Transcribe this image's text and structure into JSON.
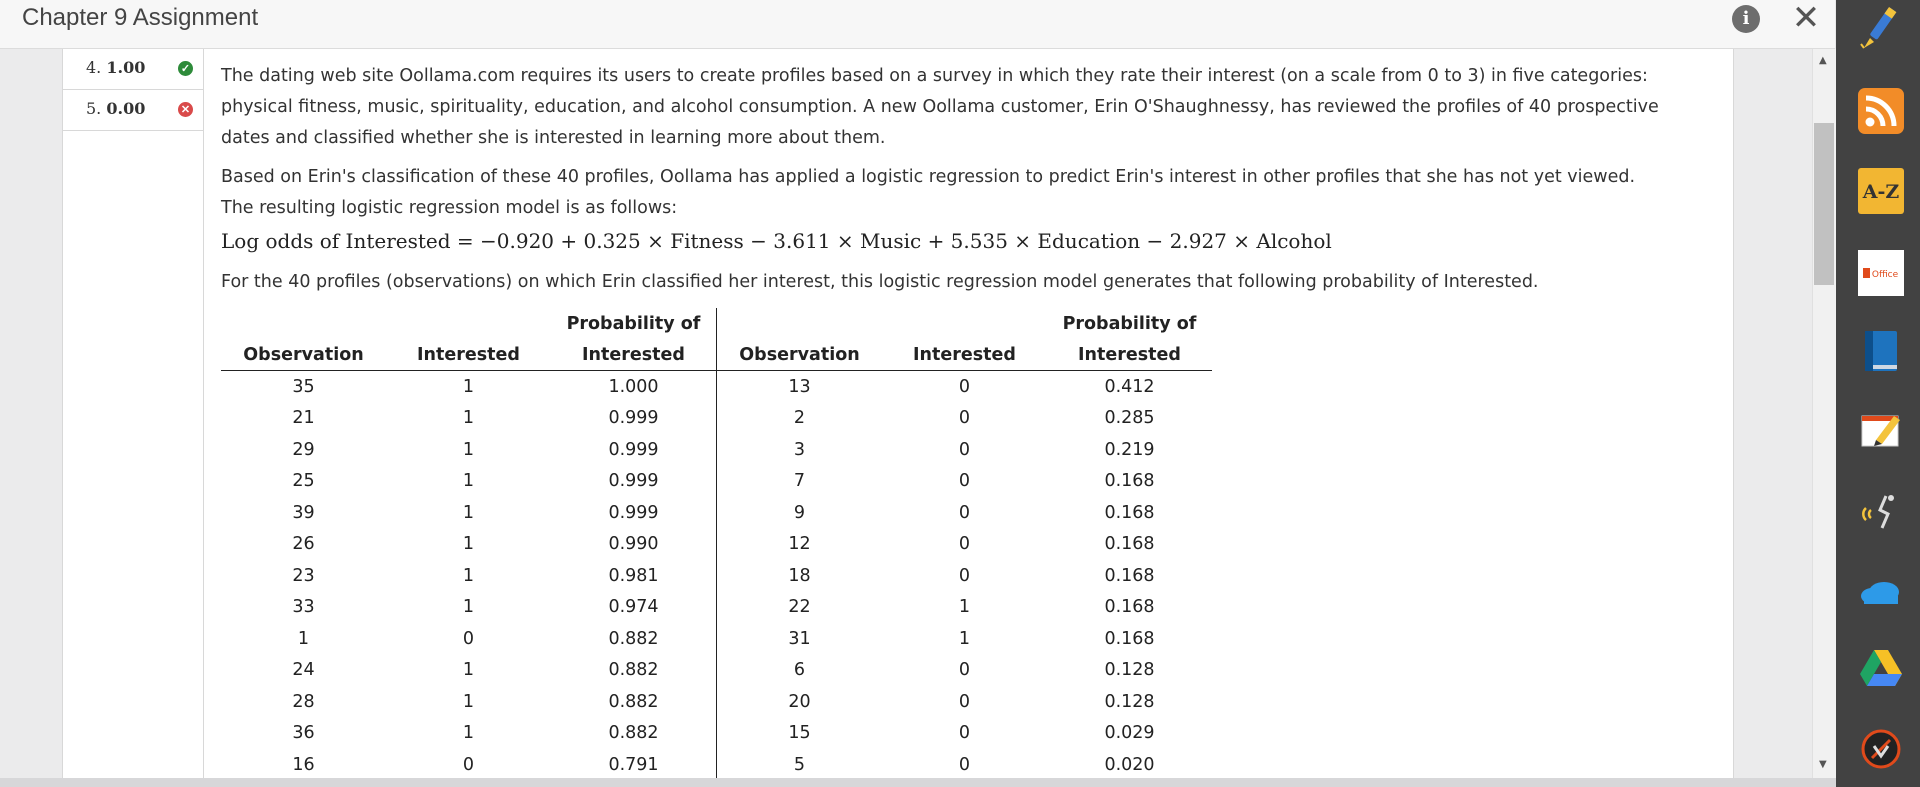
{
  "window": {
    "title": "Chapter 9 Assignment",
    "info_glyph": "i",
    "close_glyph": "✕"
  },
  "question_nav": [
    {
      "number": "4.",
      "score": "1.00",
      "status": "correct",
      "status_glyph": "✓"
    },
    {
      "number": "5.",
      "score": "0.00",
      "status": "incorrect",
      "status_glyph": "✕"
    }
  ],
  "question": {
    "p1_line1": "The dating web site Oollama.com requires its users to create profiles based on a survey in which they rate their interest (on a scale from 0 to 3) in five categories:",
    "p1_line2": "physical fitness, music, spirituality, education, and alcohol consumption. A new Oollama customer, Erin O'Shaughnessy, has reviewed the profiles of 40 prospective",
    "p1_line3": "dates and classified whether she is interested in learning more about them.",
    "p2_line1": "Based on Erin's classification of these 40 profiles, Oollama has applied a logistic regression to predict Erin's interest in other profiles that she has not yet viewed.",
    "p2_line2": "The resulting logistic regression model is as follows:",
    "formula": "Log odds of Interested = −0.920 + 0.325 × Fitness − 3.611 × Music + 5.535 × Education − 2.927 × Alcohol",
    "p3": "For the 40 profiles (observations) on which Erin classified her interest, this logistic regression model generates that following probability of Interested."
  },
  "table": {
    "header_top": "Probability of",
    "col_observation": "Observation",
    "col_interested": "Interested",
    "col_prob": "Interested",
    "rows": [
      [
        "35",
        "1",
        "1.000",
        "13",
        "0",
        "0.412"
      ],
      [
        "21",
        "1",
        "0.999",
        "2",
        "0",
        "0.285"
      ],
      [
        "29",
        "1",
        "0.999",
        "3",
        "0",
        "0.219"
      ],
      [
        "25",
        "1",
        "0.999",
        "7",
        "0",
        "0.168"
      ],
      [
        "39",
        "1",
        "0.999",
        "9",
        "0",
        "0.168"
      ],
      [
        "26",
        "1",
        "0.990",
        "12",
        "0",
        "0.168"
      ],
      [
        "23",
        "1",
        "0.981",
        "18",
        "0",
        "0.168"
      ],
      [
        "33",
        "1",
        "0.974",
        "22",
        "1",
        "0.168"
      ],
      [
        "1",
        "0",
        "0.882",
        "31",
        "1",
        "0.168"
      ],
      [
        "24",
        "1",
        "0.882",
        "6",
        "0",
        "0.128"
      ],
      [
        "28",
        "1",
        "0.882",
        "20",
        "0",
        "0.128"
      ],
      [
        "36",
        "1",
        "0.882",
        "15",
        "0",
        "0.029"
      ],
      [
        "16",
        "0",
        "0.791",
        "5",
        "0",
        "0.020"
      ]
    ]
  },
  "toolbar": {
    "items": [
      "highlighter-pen-icon",
      "rss-icon",
      "dictionary-icon",
      "office-icon",
      "book-icon",
      "notes-icon",
      "text-to-speech-icon",
      "onedrive-icon",
      "google-drive-icon",
      "screen-recorder-icon"
    ],
    "az_label": "A-Z",
    "office_label": "Office"
  },
  "colors": {
    "toolbar_bg": "#424242",
    "correct": "#2e8b3a",
    "incorrect": "#d94a4a"
  }
}
